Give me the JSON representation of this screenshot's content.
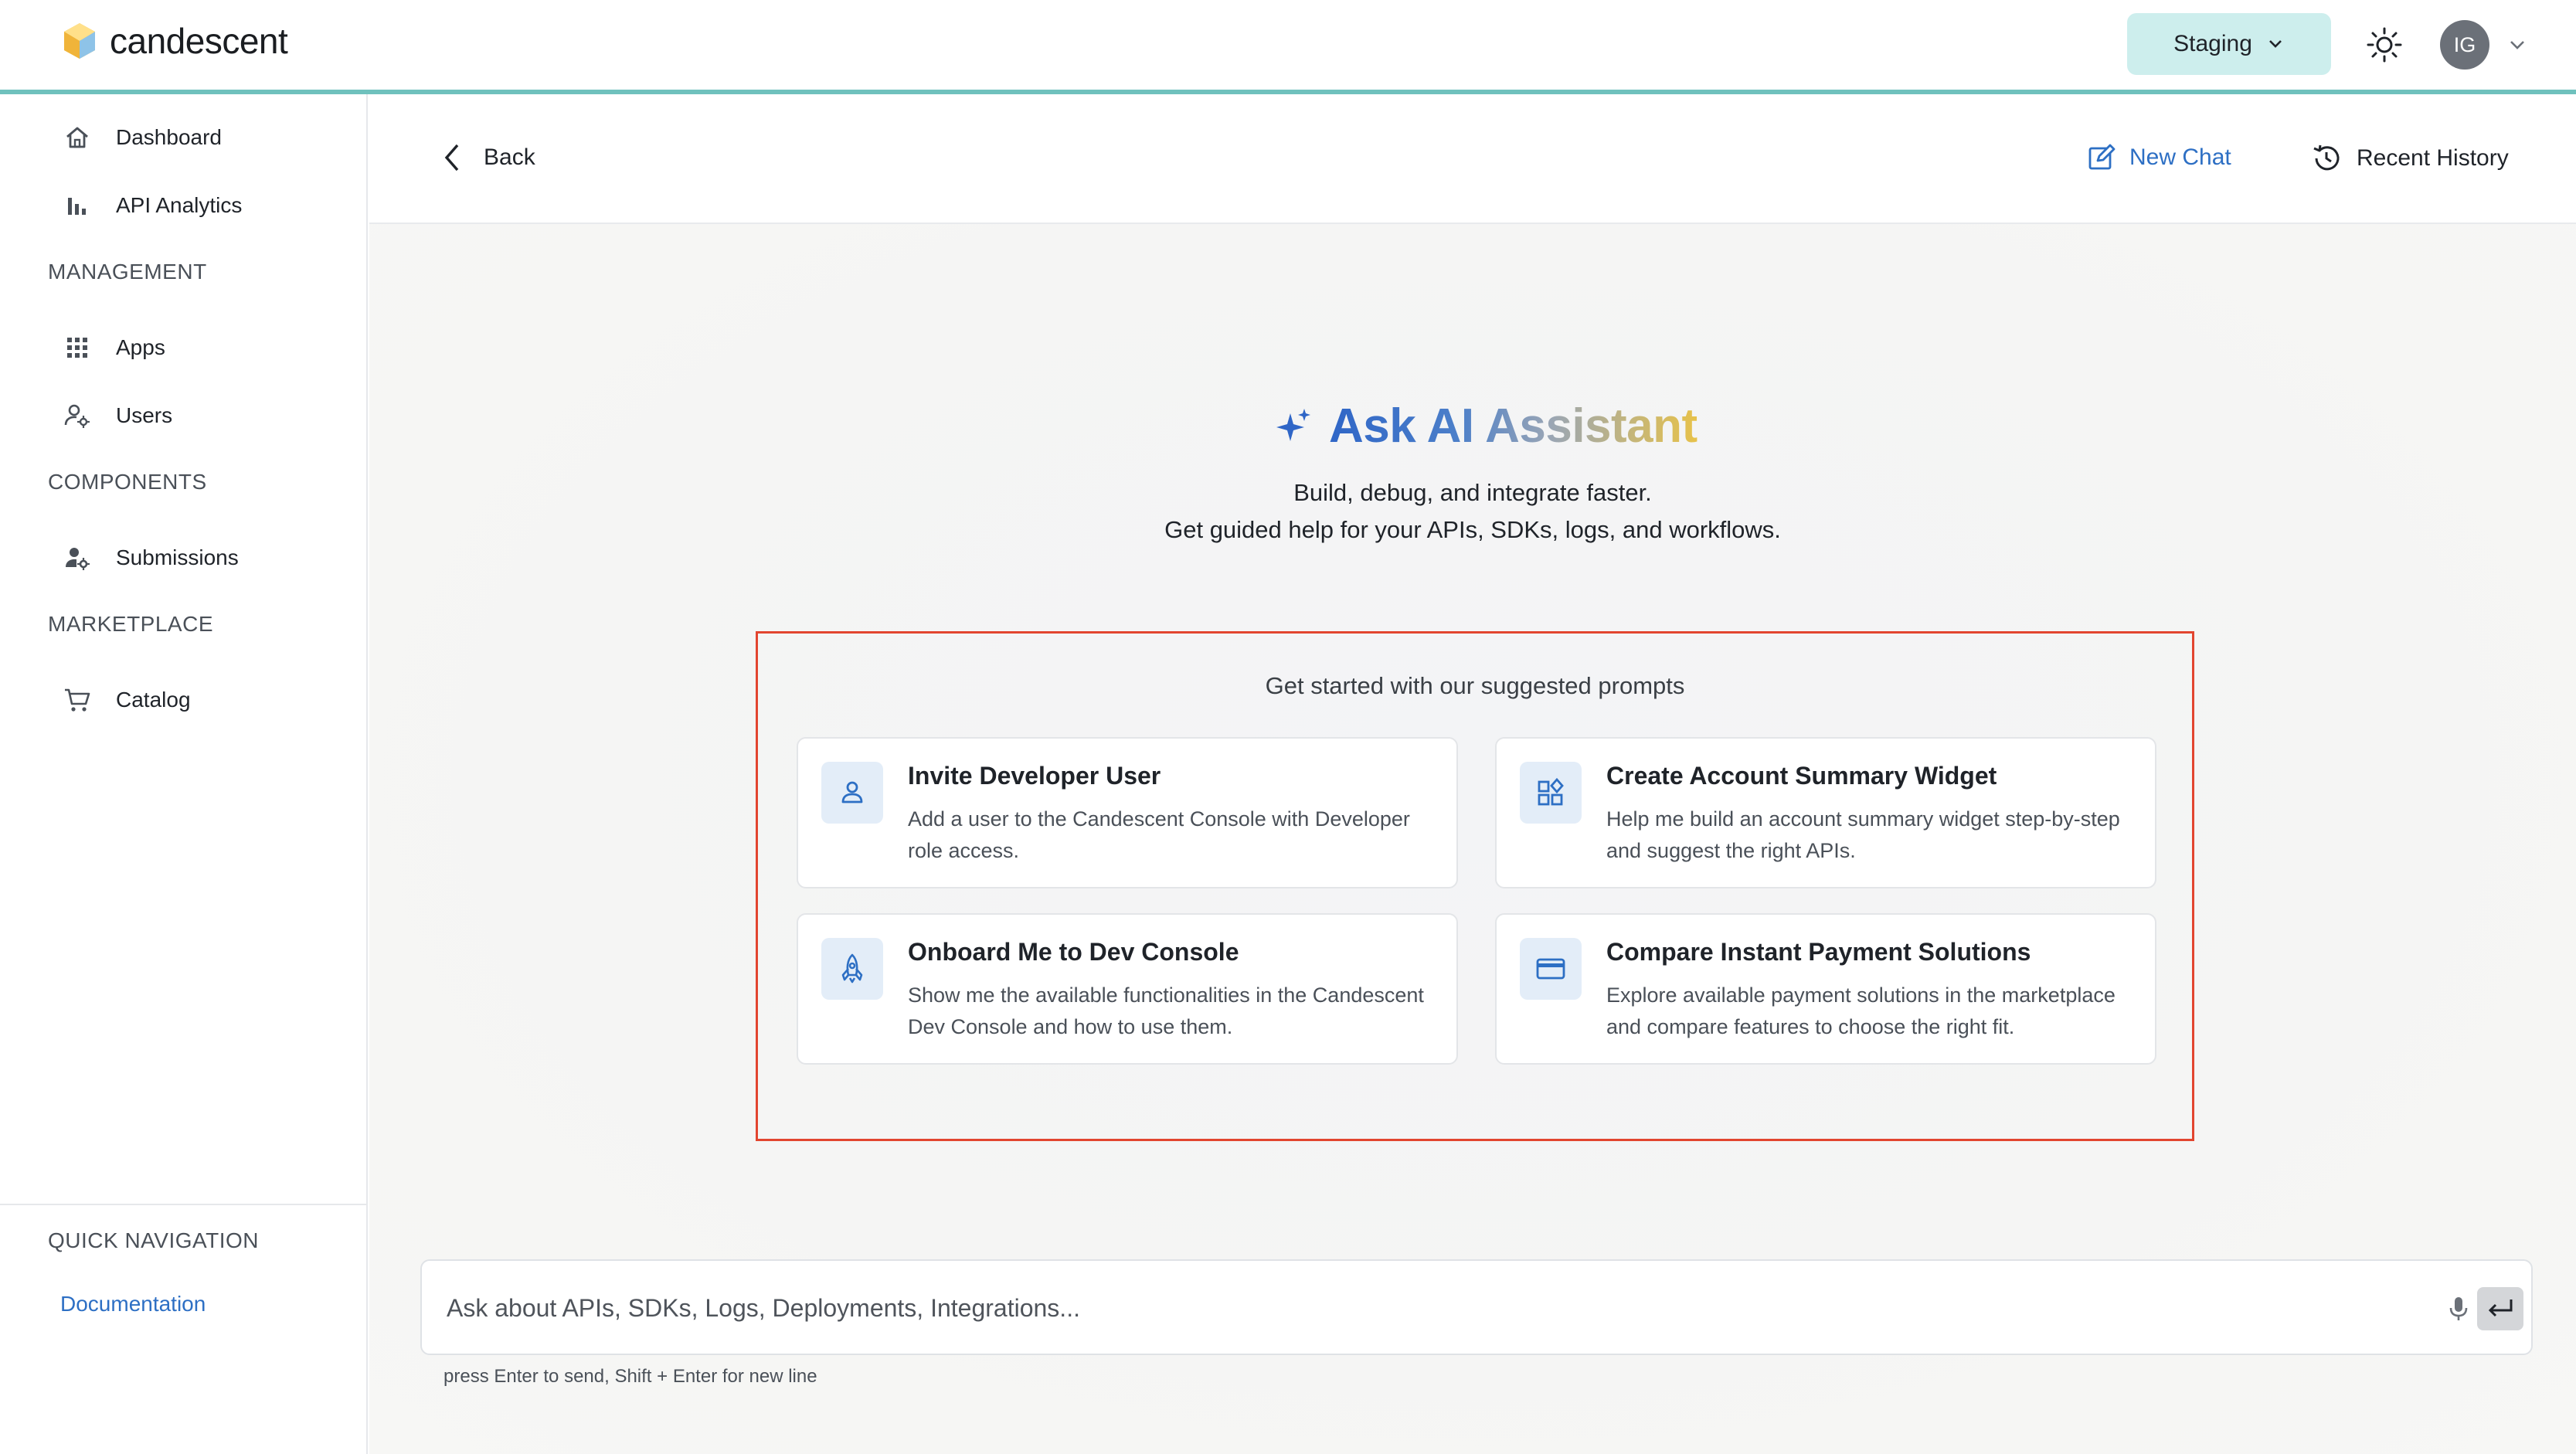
{
  "brand": {
    "name": "candescent"
  },
  "header": {
    "environment": "Staging",
    "avatar_initials": "IG"
  },
  "sidebar": {
    "items": [
      {
        "label": "Dashboard",
        "icon": "home-icon"
      },
      {
        "label": "API Analytics",
        "icon": "bar-chart-icon"
      }
    ],
    "sections": [
      {
        "title": "MANAGEMENT",
        "items": [
          {
            "label": "Apps",
            "icon": "grid-icon"
          },
          {
            "label": "Users",
            "icon": "user-gear-icon"
          }
        ]
      },
      {
        "title": "COMPONENTS",
        "items": [
          {
            "label": "Submissions",
            "icon": "user-settings-icon"
          }
        ]
      },
      {
        "title": "MARKETPLACE",
        "items": [
          {
            "label": "Catalog",
            "icon": "cart-icon"
          }
        ]
      }
    ],
    "quick_nav_title": "QUICK NAVIGATION",
    "quick_nav_link": "Documentation"
  },
  "main_header": {
    "back_label": "Back",
    "new_chat_label": "New Chat",
    "recent_history_label": "Recent History"
  },
  "hero": {
    "title": "Ask AI Assistant",
    "subtitle_line1": "Build, debug, and integrate faster.",
    "subtitle_line2": "Get guided help for your APIs, SDKs, logs, and workflows."
  },
  "prompts": {
    "heading": "Get started with our suggested prompts",
    "cards": [
      {
        "title": "Invite Developer User",
        "desc": "Add a user to the Candescent Console with Developer role access.",
        "icon": "user-icon"
      },
      {
        "title": "Create Account Summary Widget",
        "desc": "Help me build an account summary widget step-by-step and suggest the right APIs.",
        "icon": "widgets-icon"
      },
      {
        "title": "Onboard Me to Dev Console",
        "desc": "Show me the available functionalities in the Candescent Dev Console and how to use them.",
        "icon": "rocket-icon"
      },
      {
        "title": "Compare Instant Payment Solutions",
        "desc": "Explore available payment solutions in the marketplace and compare features to choose the right fit.",
        "icon": "credit-card-icon"
      }
    ]
  },
  "chat": {
    "placeholder": "Ask about APIs, SDKs, Logs, Deployments, Integrations...",
    "hint": "press Enter to send, Shift + Enter for new line"
  },
  "colors": {
    "accent_teal": "#6fc1bd",
    "env_bg": "#cdeeed",
    "link_blue": "#2d6fc4",
    "highlight_red": "#e2452f"
  }
}
